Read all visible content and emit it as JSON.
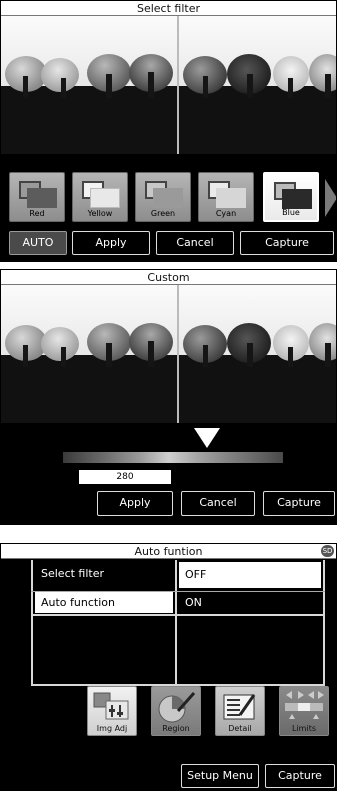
{
  "screen1": {
    "title": "Select filter",
    "filters": [
      {
        "label": "Red",
        "color": "#5c5c5c"
      },
      {
        "label": "Yellow",
        "color": "#e8e8e8"
      },
      {
        "label": "Green",
        "color": "#9a9a9a"
      },
      {
        "label": "Cyan",
        "color": "#d6d6d6"
      },
      {
        "label": "Blue",
        "color": "#2a2a2a"
      }
    ],
    "buttons": {
      "auto": "AUTO",
      "apply": "Apply",
      "cancel": "Cancel",
      "capture": "Capture"
    }
  },
  "screen2": {
    "title": "Custom",
    "value": "280",
    "buttons": {
      "apply": "Apply",
      "cancel": "Cancel",
      "capture": "Capture"
    }
  },
  "screen3": {
    "title": "Auto funtion",
    "badge": "SD",
    "menu": [
      {
        "label": "Select filter",
        "value": "OFF"
      },
      {
        "label": "Auto function",
        "value": "ON"
      }
    ],
    "tiles": [
      {
        "label": "Img Adj",
        "icon": "image-adjust-icon"
      },
      {
        "label": "Region",
        "icon": "region-icon"
      },
      {
        "label": "Detail",
        "icon": "detail-icon"
      },
      {
        "label": "Limits",
        "icon": "limits-icon"
      }
    ],
    "buttons": {
      "setup_menu": "Setup Menu",
      "capture": "Capture"
    }
  }
}
